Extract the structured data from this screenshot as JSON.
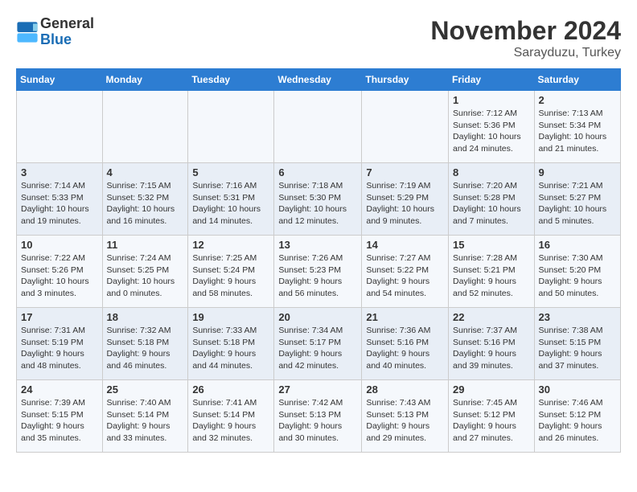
{
  "header": {
    "logo_line1": "General",
    "logo_line2": "Blue",
    "month": "November 2024",
    "location": "Sarayduzu, Turkey"
  },
  "weekdays": [
    "Sunday",
    "Monday",
    "Tuesday",
    "Wednesday",
    "Thursday",
    "Friday",
    "Saturday"
  ],
  "weeks": [
    [
      {
        "day": "",
        "info": ""
      },
      {
        "day": "",
        "info": ""
      },
      {
        "day": "",
        "info": ""
      },
      {
        "day": "",
        "info": ""
      },
      {
        "day": "",
        "info": ""
      },
      {
        "day": "1",
        "info": "Sunrise: 7:12 AM\nSunset: 5:36 PM\nDaylight: 10 hours\nand 24 minutes."
      },
      {
        "day": "2",
        "info": "Sunrise: 7:13 AM\nSunset: 5:34 PM\nDaylight: 10 hours\nand 21 minutes."
      }
    ],
    [
      {
        "day": "3",
        "info": "Sunrise: 7:14 AM\nSunset: 5:33 PM\nDaylight: 10 hours\nand 19 minutes."
      },
      {
        "day": "4",
        "info": "Sunrise: 7:15 AM\nSunset: 5:32 PM\nDaylight: 10 hours\nand 16 minutes."
      },
      {
        "day": "5",
        "info": "Sunrise: 7:16 AM\nSunset: 5:31 PM\nDaylight: 10 hours\nand 14 minutes."
      },
      {
        "day": "6",
        "info": "Sunrise: 7:18 AM\nSunset: 5:30 PM\nDaylight: 10 hours\nand 12 minutes."
      },
      {
        "day": "7",
        "info": "Sunrise: 7:19 AM\nSunset: 5:29 PM\nDaylight: 10 hours\nand 9 minutes."
      },
      {
        "day": "8",
        "info": "Sunrise: 7:20 AM\nSunset: 5:28 PM\nDaylight: 10 hours\nand 7 minutes."
      },
      {
        "day": "9",
        "info": "Sunrise: 7:21 AM\nSunset: 5:27 PM\nDaylight: 10 hours\nand 5 minutes."
      }
    ],
    [
      {
        "day": "10",
        "info": "Sunrise: 7:22 AM\nSunset: 5:26 PM\nDaylight: 10 hours\nand 3 minutes."
      },
      {
        "day": "11",
        "info": "Sunrise: 7:24 AM\nSunset: 5:25 PM\nDaylight: 10 hours\nand 0 minutes."
      },
      {
        "day": "12",
        "info": "Sunrise: 7:25 AM\nSunset: 5:24 PM\nDaylight: 9 hours\nand 58 minutes."
      },
      {
        "day": "13",
        "info": "Sunrise: 7:26 AM\nSunset: 5:23 PM\nDaylight: 9 hours\nand 56 minutes."
      },
      {
        "day": "14",
        "info": "Sunrise: 7:27 AM\nSunset: 5:22 PM\nDaylight: 9 hours\nand 54 minutes."
      },
      {
        "day": "15",
        "info": "Sunrise: 7:28 AM\nSunset: 5:21 PM\nDaylight: 9 hours\nand 52 minutes."
      },
      {
        "day": "16",
        "info": "Sunrise: 7:30 AM\nSunset: 5:20 PM\nDaylight: 9 hours\nand 50 minutes."
      }
    ],
    [
      {
        "day": "17",
        "info": "Sunrise: 7:31 AM\nSunset: 5:19 PM\nDaylight: 9 hours\nand 48 minutes."
      },
      {
        "day": "18",
        "info": "Sunrise: 7:32 AM\nSunset: 5:18 PM\nDaylight: 9 hours\nand 46 minutes."
      },
      {
        "day": "19",
        "info": "Sunrise: 7:33 AM\nSunset: 5:18 PM\nDaylight: 9 hours\nand 44 minutes."
      },
      {
        "day": "20",
        "info": "Sunrise: 7:34 AM\nSunset: 5:17 PM\nDaylight: 9 hours\nand 42 minutes."
      },
      {
        "day": "21",
        "info": "Sunrise: 7:36 AM\nSunset: 5:16 PM\nDaylight: 9 hours\nand 40 minutes."
      },
      {
        "day": "22",
        "info": "Sunrise: 7:37 AM\nSunset: 5:16 PM\nDaylight: 9 hours\nand 39 minutes."
      },
      {
        "day": "23",
        "info": "Sunrise: 7:38 AM\nSunset: 5:15 PM\nDaylight: 9 hours\nand 37 minutes."
      }
    ],
    [
      {
        "day": "24",
        "info": "Sunrise: 7:39 AM\nSunset: 5:15 PM\nDaylight: 9 hours\nand 35 minutes."
      },
      {
        "day": "25",
        "info": "Sunrise: 7:40 AM\nSunset: 5:14 PM\nDaylight: 9 hours\nand 33 minutes."
      },
      {
        "day": "26",
        "info": "Sunrise: 7:41 AM\nSunset: 5:14 PM\nDaylight: 9 hours\nand 32 minutes."
      },
      {
        "day": "27",
        "info": "Sunrise: 7:42 AM\nSunset: 5:13 PM\nDaylight: 9 hours\nand 30 minutes."
      },
      {
        "day": "28",
        "info": "Sunrise: 7:43 AM\nSunset: 5:13 PM\nDaylight: 9 hours\nand 29 minutes."
      },
      {
        "day": "29",
        "info": "Sunrise: 7:45 AM\nSunset: 5:12 PM\nDaylight: 9 hours\nand 27 minutes."
      },
      {
        "day": "30",
        "info": "Sunrise: 7:46 AM\nSunset: 5:12 PM\nDaylight: 9 hours\nand 26 minutes."
      }
    ]
  ]
}
